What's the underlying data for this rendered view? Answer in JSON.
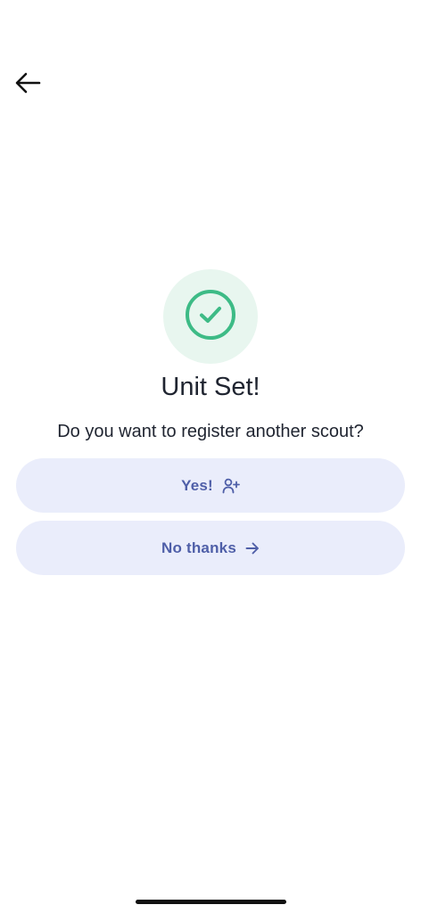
{
  "header": {
    "back_icon": "arrow-left-icon"
  },
  "success": {
    "icon": "check-circle-icon",
    "title": "Unit Set!",
    "question": "Do you want to register another scout?",
    "accent_color": "#3dbb86",
    "badge_bg_color": "#e8f6ef"
  },
  "actions": {
    "yes_label": "Yes!",
    "yes_icon": "add-user-icon",
    "no_label": "No thanks",
    "no_icon": "arrow-right-icon",
    "button_bg_color": "#eaedfb",
    "button_text_color": "#4f5fa8"
  }
}
